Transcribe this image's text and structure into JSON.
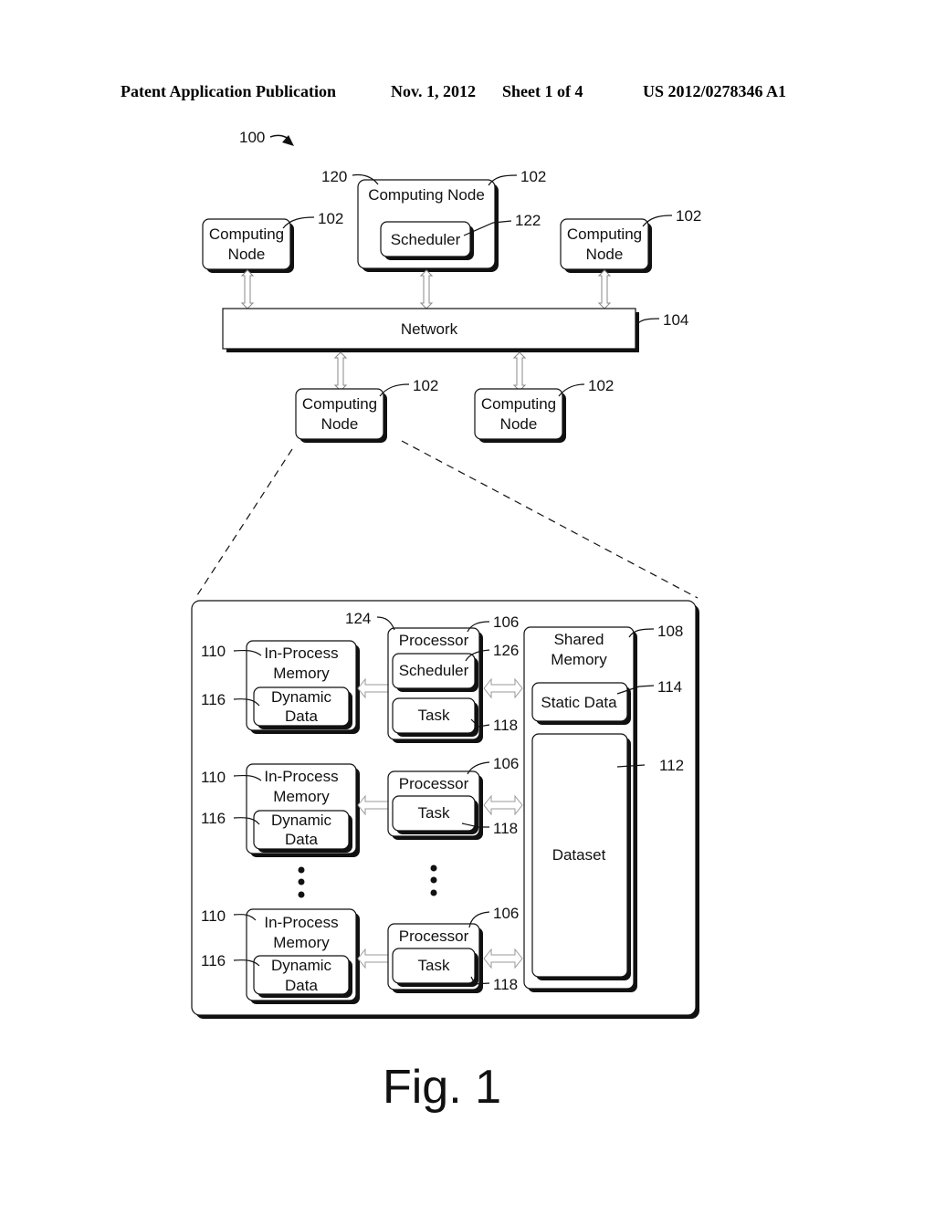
{
  "header": {
    "publication": "Patent Application Publication",
    "date": "Nov. 1, 2012",
    "sheet": "Sheet 1 of 4",
    "number": "US 2012/0278346 A1"
  },
  "figure": {
    "caption": "Fig. 1",
    "system_ref": "100",
    "top": {
      "nodes": [
        {
          "label_l1": "Computing",
          "label_l2": "Node",
          "ref": "102"
        },
        {
          "label": "Computing Node",
          "ref": "102",
          "ref2": "120",
          "scheduler": "Scheduler",
          "scheduler_ref": "122"
        },
        {
          "label_l1": "Computing",
          "label_l2": "Node",
          "ref": "102"
        },
        {
          "label_l1": "Computing",
          "label_l2": "Node",
          "ref": "102"
        },
        {
          "label_l1": "Computing",
          "label_l2": "Node",
          "ref": "102"
        }
      ],
      "network": {
        "label": "Network",
        "ref": "104"
      }
    },
    "detail": {
      "rows": [
        {
          "mem_l1": "In-Process",
          "mem_l2": "Memory",
          "mem_ref": "110",
          "dyn_l1": "Dynamic",
          "dyn_l2": "Data",
          "dyn_ref": "116",
          "proc": "Processor",
          "proc_ref": "106",
          "proc_ref2": "124",
          "sched": "Scheduler",
          "sched_ref": "126",
          "task": "Task",
          "task_ref": "118"
        },
        {
          "mem_l1": "In-Process",
          "mem_l2": "Memory",
          "mem_ref": "110",
          "dyn_l1": "Dynamic",
          "dyn_l2": "Data",
          "dyn_ref": "116",
          "proc": "Processor",
          "proc_ref": "106",
          "task": "Task",
          "task_ref": "118"
        },
        {
          "mem_l1": "In-Process",
          "mem_l2": "Memory",
          "mem_ref": "110",
          "dyn_l1": "Dynamic",
          "dyn_l2": "Data",
          "dyn_ref": "116",
          "proc": "Processor",
          "proc_ref": "106",
          "task": "Task",
          "task_ref": "118"
        }
      ],
      "shared": {
        "l1": "Shared",
        "l2": "Memory",
        "ref": "108",
        "static": "Static Data",
        "static_ref": "114",
        "dataset": "Dataset",
        "dataset_ref": "112"
      }
    }
  }
}
